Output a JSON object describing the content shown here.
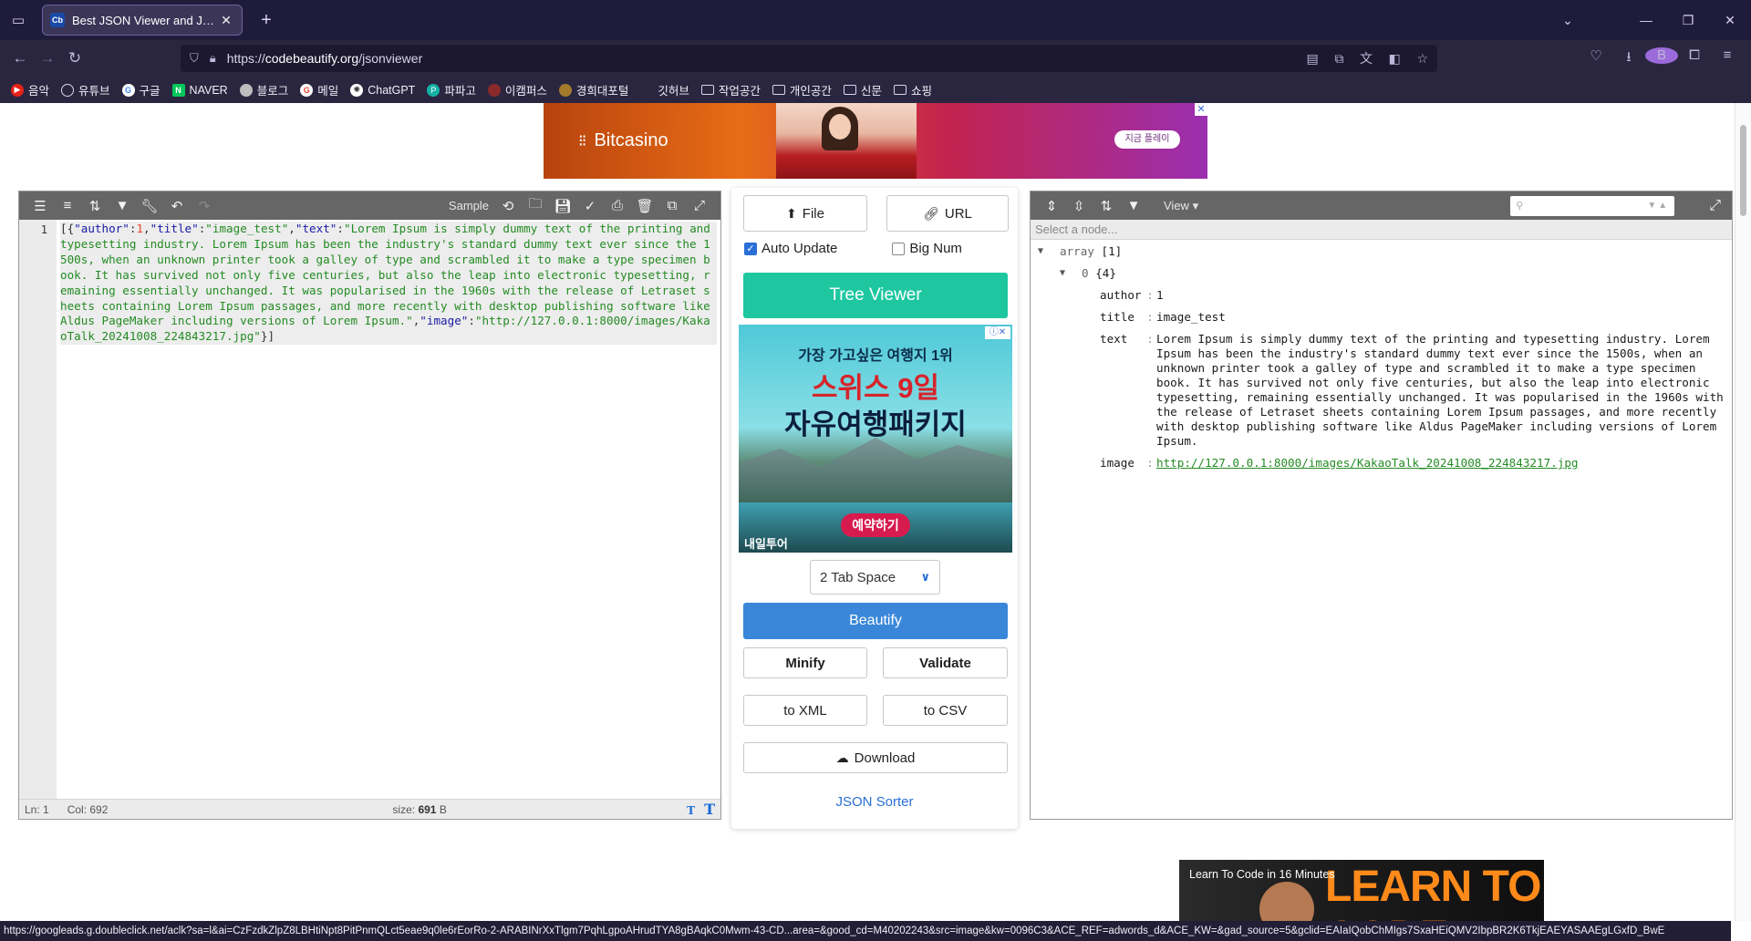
{
  "browser": {
    "tab_title": "Best JSON Viewer and JSON Beautifier Online",
    "tab_favicon": "Cb",
    "url_host": "codebeautify.org",
    "url_path": "/jsonviewer",
    "url_scheme": "https://",
    "profile_letter": "B",
    "bookmarks": [
      {
        "label": "음악",
        "icon": "youtube-music-icon",
        "color": "#e62117"
      },
      {
        "label": "유튜브",
        "icon": "globe-icon",
        "color": "#3b6bd6"
      },
      {
        "label": "구글",
        "icon": "google-icon",
        "color": "#4285f4"
      },
      {
        "label": "NAVER",
        "icon": "naver-icon",
        "color": "#03c75a"
      },
      {
        "label": "블로그",
        "icon": "blog-icon",
        "color": "#8f8f8f"
      },
      {
        "label": "메일",
        "icon": "gmail-icon",
        "color": "#ea4335"
      },
      {
        "label": "ChatGPT",
        "icon": "chatgpt-icon",
        "color": "#555555"
      },
      {
        "label": "파파고",
        "icon": "papago-icon",
        "color": "#14b1a4"
      },
      {
        "label": "이캠퍼스",
        "icon": "ecampus-icon",
        "color": "#8b2a2a"
      },
      {
        "label": "경희대포털",
        "icon": "portal-icon",
        "color": "#a37a2a"
      },
      {
        "label": "깃허브",
        "icon": "github-icon",
        "color": "#222222"
      },
      {
        "label": "작업공간",
        "icon": "folder-icon",
        "color": ""
      },
      {
        "label": "개인공간",
        "icon": "folder-icon",
        "color": ""
      },
      {
        "label": "신문",
        "icon": "folder-icon",
        "color": ""
      },
      {
        "label": "쇼핑",
        "icon": "folder-icon",
        "color": ""
      }
    ],
    "status_url": "https://googleads.g.doubleclick.net/aclk?sa=l&ai=CzFzdkZlpZ8LBHtiNpt8PitPnmQLct5eae9q0le6rEorRo-2-ARABINrXxTlgm7PqhLgpoAHrudTYA8gBAqkC0Mwm-43-CD...area=&good_cd=M40202243&src=image&kw=0096C3&ACE_REF=adwords_d&ACE_KW=&gad_source=5&gclid=EAIaIQobChMIgs7SxaHEiQMV2IbpBR2K6TkjEAEYASAAEgLGxfD_BwE"
  },
  "top_ad": {
    "brand": "Bitcasino",
    "cta": "지금 플레이"
  },
  "editor": {
    "sample_label": "Sample",
    "line_number": "1",
    "status": {
      "ln": "Ln: 1",
      "col": "Col: 692",
      "size_label": "size:",
      "size_value": "691",
      "size_unit": "B"
    },
    "code": {
      "open": "[{",
      "k_author": "\"author\"",
      "v_author": "1",
      "k_title": "\"title\"",
      "v_title": "\"image_test\"",
      "k_text": "\"text\"",
      "v_text": "\"Lorem Ipsum is simply dummy text of the printing and typesetting industry. Lorem Ipsum has been the industry's standard dummy text ever since the 1500s, when an unknown printer took a galley of type and scrambled it to make a type specimen book. It has survived not only five centuries, but also the leap into electronic typesetting, remaining essentially unchanged. It was popularised in the 1960s with the release of Letraset sheets containing Lorem Ipsum passages, and more recently with desktop publishing software like Aldus PageMaker including versions of Lorem Ipsum.\"",
      "k_image": "\"image\"",
      "v_image": "\"http://127.0.0.1:8000/images/KakaoTalk_20241008_224843217.jpg\"",
      "close": "}]"
    }
  },
  "middle": {
    "file_label": "File",
    "url_label": "URL",
    "auto_update_label": "Auto Update",
    "auto_update_checked": true,
    "big_num_label": "Big Num",
    "big_num_checked": false,
    "tree_viewer_label": "Tree Viewer",
    "ad": {
      "line1": "가장 가고싶은 여행지 1위",
      "line2": "스위스 9일",
      "line3": "자유여행패키지",
      "cta": "예약하기",
      "brand": "내일투어"
    },
    "indent_selected": "2 Tab Space",
    "beautify_label": "Beautify",
    "minify_label": "Minify",
    "validate_label": "Validate",
    "to_xml_label": "to XML",
    "to_csv_label": "to CSV",
    "download_label": "Download",
    "sorter_label": "JSON Sorter"
  },
  "viewer": {
    "view_label": "View",
    "path_placeholder": "Select a node...",
    "root_label": "array",
    "root_count": "[1]",
    "item_index": "0",
    "item_count": "{4}",
    "fields": [
      {
        "key": "author",
        "value": "1",
        "link": false
      },
      {
        "key": "title",
        "value": "image_test",
        "link": false
      },
      {
        "key": "text",
        "value": "Lorem Ipsum is simply dummy text of the printing and typesetting industry. Lorem Ipsum has been the industry's standard dummy text ever since the 1500s, when an unknown printer took a galley of type and scrambled it to make a type specimen book. It has survived not only five centuries, but also the leap into electronic typesetting, remaining essentially unchanged. It was popularised in the 1960s with the release of Letraset sheets containing Lorem Ipsum passages, and more recently with desktop publishing software like Aldus PageMaker including versions of Lorem Ipsum.",
        "link": false
      },
      {
        "key": "image",
        "value": "http://127.0.0.1:8000/images/KakaoTalk_20241008_224843217.jpg",
        "link": true
      }
    ]
  },
  "bottom_ad": {
    "title": "Learn To Code in 16 Minutes",
    "headline": "LEARN TO CODE"
  }
}
